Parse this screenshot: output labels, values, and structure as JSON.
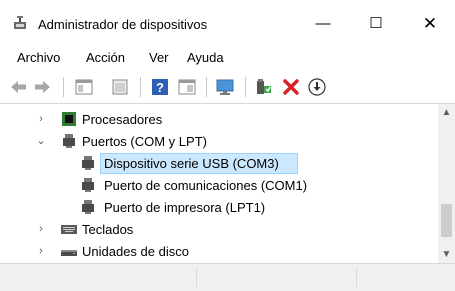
{
  "window": {
    "title": "Administrador de dispositivos",
    "app_icon": "device-manager-icon",
    "controls": {
      "minimize": "—",
      "maximize": "☐",
      "close": "✕"
    }
  },
  "menu": [
    "Archivo",
    "Acción",
    "Ver",
    "Ayuda"
  ],
  "toolbar": {
    "icons": [
      "back-arrow-icon",
      "forward-arrow-icon",
      "properties-panel-icon",
      "window-icon",
      "help-icon",
      "details-panel-icon",
      "monitor-scan-icon",
      "add-driver-icon",
      "uninstall-icon",
      "download-icon"
    ]
  },
  "tree": {
    "items": [
      {
        "label": "Procesadores",
        "expander": "›",
        "icon": "processor-icon"
      },
      {
        "label": "Puertos (COM y LPT)",
        "expander": "⌄",
        "icon": "port-icon"
      },
      {
        "label": "Dispositivo serie USB (COM3)",
        "icon": "serial-port-icon",
        "selected": true
      },
      {
        "label": "Puerto de comunicaciones (COM1)",
        "icon": "serial-port-icon"
      },
      {
        "label": "Puerto de impresora (LPT1)",
        "icon": "printer-port-icon"
      },
      {
        "label": "Teclados",
        "expander": "›",
        "icon": "keyboard-icon"
      },
      {
        "label": "Unidades de disco",
        "expander": "›",
        "icon": "disk-drive-icon"
      }
    ],
    "selection_color": "#cce8ff"
  },
  "scrollbar": {
    "up": "▲",
    "down": "▼"
  }
}
